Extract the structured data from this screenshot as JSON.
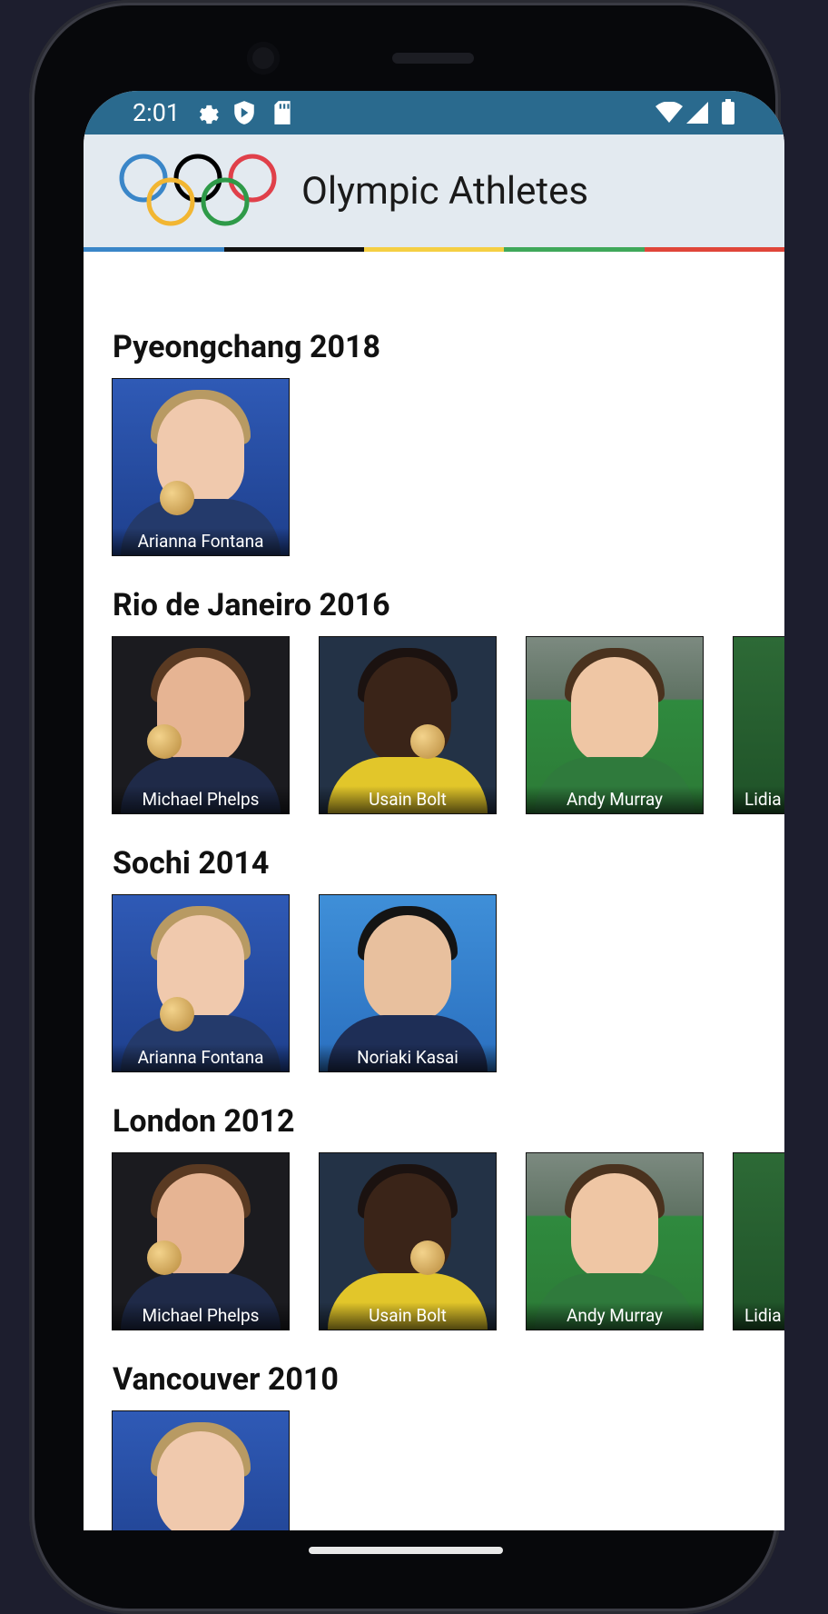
{
  "status_bar": {
    "time": "2:01",
    "left_icons": [
      "gear-icon",
      "shield-icon",
      "sd-card-icon"
    ],
    "right_icons": [
      "wifi-icon",
      "signal-icon",
      "battery-icon"
    ]
  },
  "app": {
    "title": "Olympic Athletes",
    "logo": "olympic-rings-icon",
    "ring_colors": [
      "#3a86c8",
      "#000000",
      "#f2b632",
      "#2e9a48",
      "#e0404a"
    ],
    "stripe_colors": [
      "#3a86c8",
      "#111111",
      "#f5cf43",
      "#3fa85a",
      "#e0463a"
    ]
  },
  "athletes": {
    "arianna": "Arianna Fontana",
    "michael": "Michael Phelps",
    "usain": "Usain Bolt",
    "andy": "Andy Murray",
    "lidia": "Lidia",
    "noriaki": "Noriaki Kasai"
  },
  "sections": [
    {
      "title": "Pyeongchang 2018",
      "athletes": [
        "Arianna Fontana"
      ]
    },
    {
      "title": "Rio de Janeiro 2016",
      "athletes": [
        "Michael Phelps",
        "Usain Bolt",
        "Andy Murray",
        "Lidia"
      ]
    },
    {
      "title": "Sochi 2014",
      "athletes": [
        "Arianna Fontana",
        "Noriaki Kasai"
      ]
    },
    {
      "title": "London 2012",
      "athletes": [
        "Michael Phelps",
        "Usain Bolt",
        "Andy Murray",
        "Lidia"
      ]
    },
    {
      "title": "Vancouver 2010",
      "athletes": [
        ""
      ]
    }
  ]
}
